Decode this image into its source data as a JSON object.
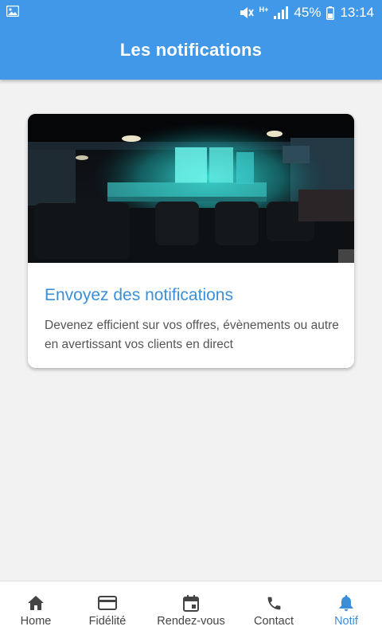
{
  "status_bar": {
    "battery": "45%",
    "time": "13:14",
    "network": "H+"
  },
  "header": {
    "title": "Les notifications"
  },
  "card": {
    "title": "Envoyez des notifications",
    "description": "Devenez efficient sur vos offres, évènements ou autre en avertissant vos clients en direct"
  },
  "bottom_nav": {
    "items": [
      {
        "label": "Home",
        "icon": "home-icon"
      },
      {
        "label": "Fidélité",
        "icon": "credit-card-icon"
      },
      {
        "label": "Rendez-vous",
        "icon": "calendar-icon"
      },
      {
        "label": "Contact",
        "icon": "phone-icon"
      },
      {
        "label": "Notif",
        "icon": "bell-icon",
        "active": true
      }
    ]
  },
  "colors": {
    "primary": "#4198e9",
    "accent": "#3b8fd9",
    "background": "#f2f2f2"
  }
}
